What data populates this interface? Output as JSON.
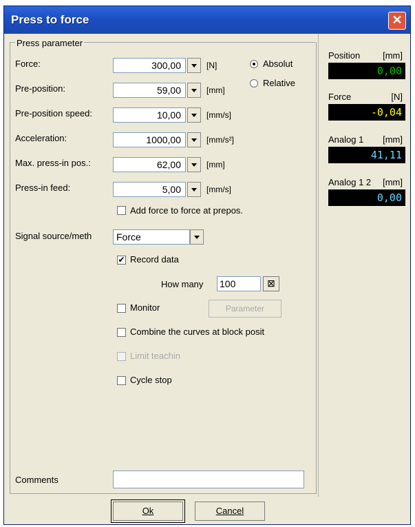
{
  "window": {
    "title": "Press to force"
  },
  "group": {
    "title": "Press parameter"
  },
  "params": [
    {
      "label": "Force:",
      "value": "300,00",
      "unit": "[N]"
    },
    {
      "label": "Pre-position:",
      "value": "59,00",
      "unit": "[mm]"
    },
    {
      "label": "Pre-position speed:",
      "value": "10,00",
      "unit": "[mm/s]"
    },
    {
      "label": "Acceleration:",
      "value": "1000,00",
      "unit": "[mm/s²]"
    },
    {
      "label": "Max. press-in pos.:",
      "value": "62,00",
      "unit": "[mm]"
    },
    {
      "label": "Press-in feed:",
      "value": "5,00",
      "unit": "[mm/s]"
    }
  ],
  "mode": {
    "absolut": "Absolut",
    "relative": "Relative",
    "selected": "Absolut"
  },
  "add_force": {
    "label": "Add force to force at prepos.",
    "checked": false
  },
  "signal": {
    "label": "Signal source/meth",
    "value": "Force"
  },
  "record": {
    "label": "Record data",
    "checked": true,
    "how_many_label": "How many",
    "how_many_value": "100"
  },
  "monitor": {
    "label": "Monitor",
    "checked": false,
    "parameter_button": "Parameter"
  },
  "combine": {
    "label": "Combine the curves at block posit",
    "checked": false
  },
  "limit": {
    "label": "Limit teachin",
    "checked": false,
    "disabled": true
  },
  "cycle": {
    "label": "Cycle stop",
    "checked": false
  },
  "comments": {
    "label": "Comments",
    "value": ""
  },
  "monitors": [
    {
      "label": "Position",
      "unit": "[mm]",
      "value": "0,00",
      "color": "#00c000"
    },
    {
      "label": "Force",
      "unit": "[N]",
      "value": "-0,04",
      "color": "#ffff00"
    },
    {
      "label": "Analog 1",
      "unit": "[mm]",
      "value": "41,11",
      "color": "#60d8ff"
    },
    {
      "label": "Analog 1 2",
      "unit": "[mm]",
      "value": "0,00",
      "color": "#60d8ff"
    }
  ],
  "buttons": {
    "ok": "Ok",
    "cancel": "Cancel"
  }
}
